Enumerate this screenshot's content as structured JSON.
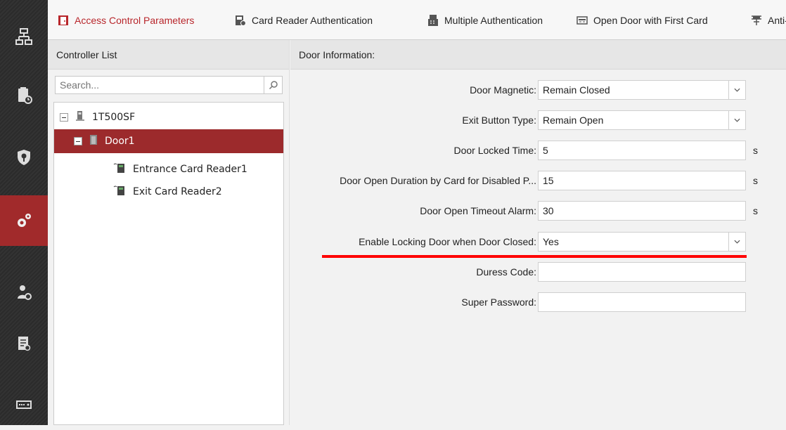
{
  "tabs": [
    {
      "label": "Access Control Parameters",
      "icon": "door-icon",
      "active": true
    },
    {
      "label": "Card Reader Authentication",
      "icon": "card-reader-icon"
    },
    {
      "label": "Multiple Authentication",
      "icon": "multi-auth-icon"
    },
    {
      "label": "Open Door with First Card",
      "icon": "first-card-icon"
    },
    {
      "label": "Anti-passback",
      "icon": "anti-passback-icon"
    }
  ],
  "leftnav": [
    {
      "icon": "device-tree-icon"
    },
    {
      "icon": "schedule-icon"
    },
    {
      "icon": "security-icon"
    },
    {
      "icon": "settings-gears-icon",
      "active": true
    },
    {
      "icon": "person-camera-icon"
    },
    {
      "icon": "log-search-icon"
    },
    {
      "icon": "device-icon"
    }
  ],
  "controller_list": {
    "header": "Controller List",
    "search_placeholder": "Search...",
    "tree": [
      {
        "label": "1T500SF",
        "level": 0,
        "icon": "controller-icon"
      },
      {
        "label": "Door1",
        "level": 1,
        "icon": "door-icon",
        "selected": true
      },
      {
        "label": "Entrance Card Reader1",
        "level": 2,
        "icon": "card-reader-icon"
      },
      {
        "label": "Exit Card Reader2",
        "level": 2,
        "icon": "card-reader-icon"
      }
    ]
  },
  "door_info": {
    "header": "Door Information:",
    "fields": [
      {
        "label": "Door Magnetic:",
        "value": "Remain Closed",
        "type": "select"
      },
      {
        "label": "Exit Button Type:",
        "value": "Remain Open",
        "type": "select"
      },
      {
        "label": "Door Locked Time:",
        "value": "5",
        "type": "input",
        "unit": "s"
      },
      {
        "label": "Door Open Duration by Card for Disabled P...",
        "value": "15",
        "type": "input",
        "unit": "s"
      },
      {
        "label": "Door Open Timeout Alarm:",
        "value": "30",
        "type": "input",
        "unit": "s"
      },
      {
        "label": "Enable Locking Door when Door Closed:",
        "value": "Yes",
        "type": "select"
      },
      {
        "label": "Duress Code:",
        "value": "",
        "type": "input"
      },
      {
        "label": "Super Password:",
        "value": "",
        "type": "input"
      }
    ]
  },
  "colors": {
    "accent": "#a12a2b",
    "highlight": "#ff0000"
  }
}
